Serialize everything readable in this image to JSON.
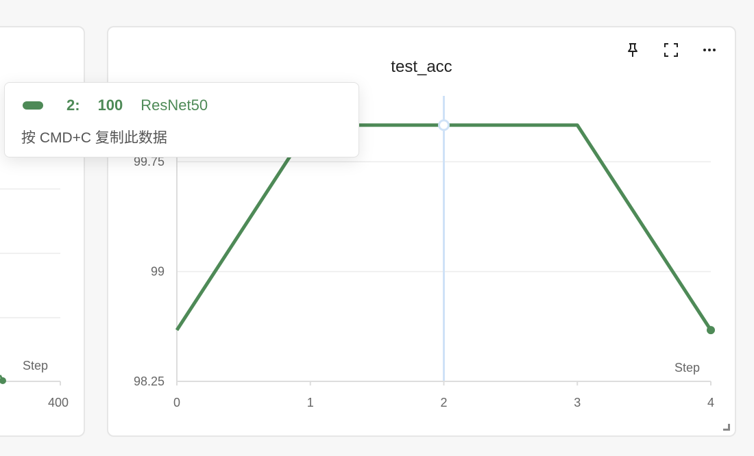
{
  "left_panel": {
    "axis_label": "Step",
    "tick_partial": "400"
  },
  "main_panel": {
    "toolbar": {
      "pin_icon": "pin-icon",
      "fullscreen_icon": "fullscreen-icon",
      "more_icon": "more-icon"
    }
  },
  "chart_data": {
    "type": "line",
    "title": "test_acc",
    "xlabel": "Step",
    "ylabel": "",
    "x": [
      0,
      1,
      2,
      3,
      4
    ],
    "series": [
      {
        "name": "ResNet50",
        "color": "#4e8a57",
        "values": [
          98.6,
          100,
          100,
          100,
          98.6
        ]
      }
    ],
    "xlim": [
      0,
      4
    ],
    "ylim": [
      98.25,
      100.2
    ],
    "x_ticks": [
      "0",
      "1",
      "2",
      "3",
      "4"
    ],
    "y_ticks": [
      {
        "value": 98.25,
        "label": "98.25"
      },
      {
        "value": 99,
        "label": "99"
      },
      {
        "value": 99.75,
        "label": "99.75"
      }
    ],
    "grid": true,
    "hover_x": 2
  },
  "tooltip": {
    "step": "2:",
    "value": "100",
    "series": "ResNet50",
    "hint": "按 CMD+C 复制此数据"
  },
  "colors": {
    "series": "#4e8a57",
    "hover_line": "#cfe2f7",
    "grid": "#ececec",
    "axis": "#dddddd"
  }
}
